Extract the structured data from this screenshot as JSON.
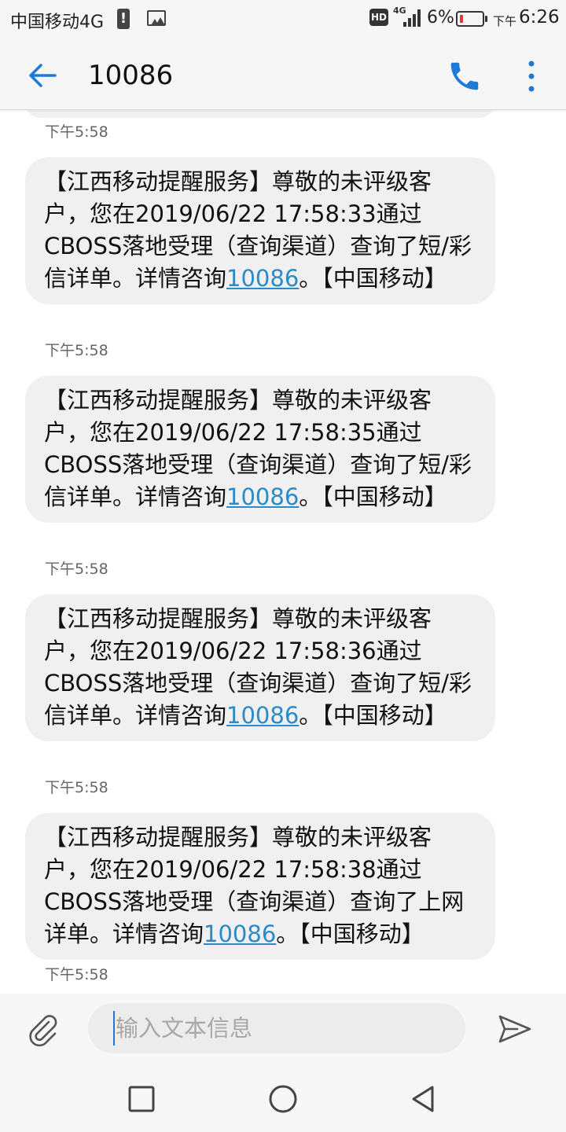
{
  "status_bar": {
    "carrier": "中国移动4G",
    "hd": "HD",
    "network": "4G",
    "battery": "6%",
    "time_prefix": "下午",
    "time": "6:26"
  },
  "header": {
    "title": "10086",
    "icons": {
      "back": "arrow-left-icon",
      "call": "phone-icon",
      "more": "more-vertical-icon"
    },
    "accent_color": "#1e7ad6"
  },
  "conversation": {
    "top_timestamp": "下午5:58",
    "messages": [
      {
        "text_before": "【江西移动提醒服务】尊敬的未评级客户，您在2019/06/22 17:58:33通过CBOSS落地受理（查询渠道）查询了短/彩信详单。详情咨询",
        "link": "10086",
        "text_after": "。【中国移动】",
        "time": "下午5:58"
      },
      {
        "text_before": "【江西移动提醒服务】尊敬的未评级客户，您在2019/06/22 17:58:35通过CBOSS落地受理（查询渠道）查询了短/彩信详单。详情咨询",
        "link": "10086",
        "text_after": "。【中国移动】",
        "time": "下午5:58"
      },
      {
        "text_before": "【江西移动提醒服务】尊敬的未评级客户，您在2019/06/22 17:58:36通过CBOSS落地受理（查询渠道）查询了短/彩信详单。详情咨询",
        "link": "10086",
        "text_after": "。【中国移动】",
        "time": "下午5:58"
      },
      {
        "text_before": "【江西移动提醒服务】尊敬的未评级客户，您在2019/06/22 17:58:38通过CBOSS落地受理（查询渠道）查询了上网详单。详情咨询",
        "link": "10086",
        "text_after": "。【中国移动】",
        "time": "下午5:58"
      }
    ],
    "bubble_color": "#f0f0f0",
    "link_color": "#2a8bc8"
  },
  "composer": {
    "placeholder": "输入文本信息",
    "value": "",
    "icons": {
      "attach": "paperclip-icon",
      "send": "send-icon"
    }
  },
  "nav_bar": {
    "icons": [
      "square-recents-icon",
      "circle-home-icon",
      "triangle-back-icon"
    ]
  }
}
